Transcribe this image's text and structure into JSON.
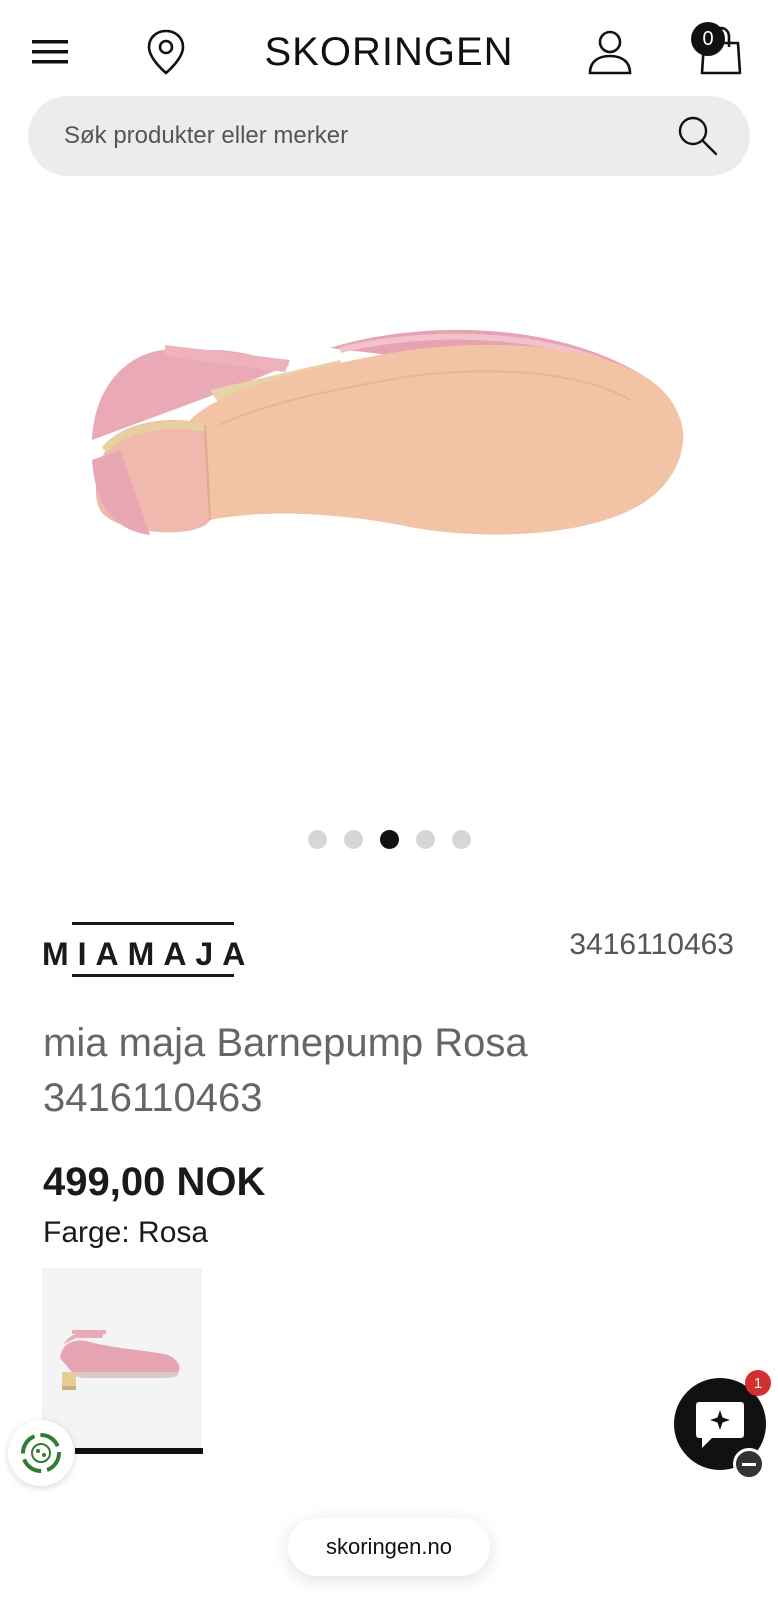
{
  "header": {
    "logo": "SKORINGEN",
    "cart_count": "0"
  },
  "search": {
    "placeholder": "Søk produkter eller merker"
  },
  "carousel": {
    "image_alt": "sole of pink girls pump",
    "total_slides": 5,
    "active_slide": 3
  },
  "product": {
    "brand": "MIAMAJA",
    "article_number": "3416110463",
    "title": "mia maja Barnepump Rosa 3416110463",
    "price": "499,00 NOK",
    "color_line": "Farge: Rosa"
  },
  "chat": {
    "badge": "1"
  },
  "browser": {
    "url": "skoringen.no"
  },
  "colors": {
    "accent": "#111111",
    "badge_red": "#d32f2f",
    "search_bg": "#ececec",
    "shoe_pink": "#e8a8b4",
    "sole": "#f2c4a6"
  }
}
